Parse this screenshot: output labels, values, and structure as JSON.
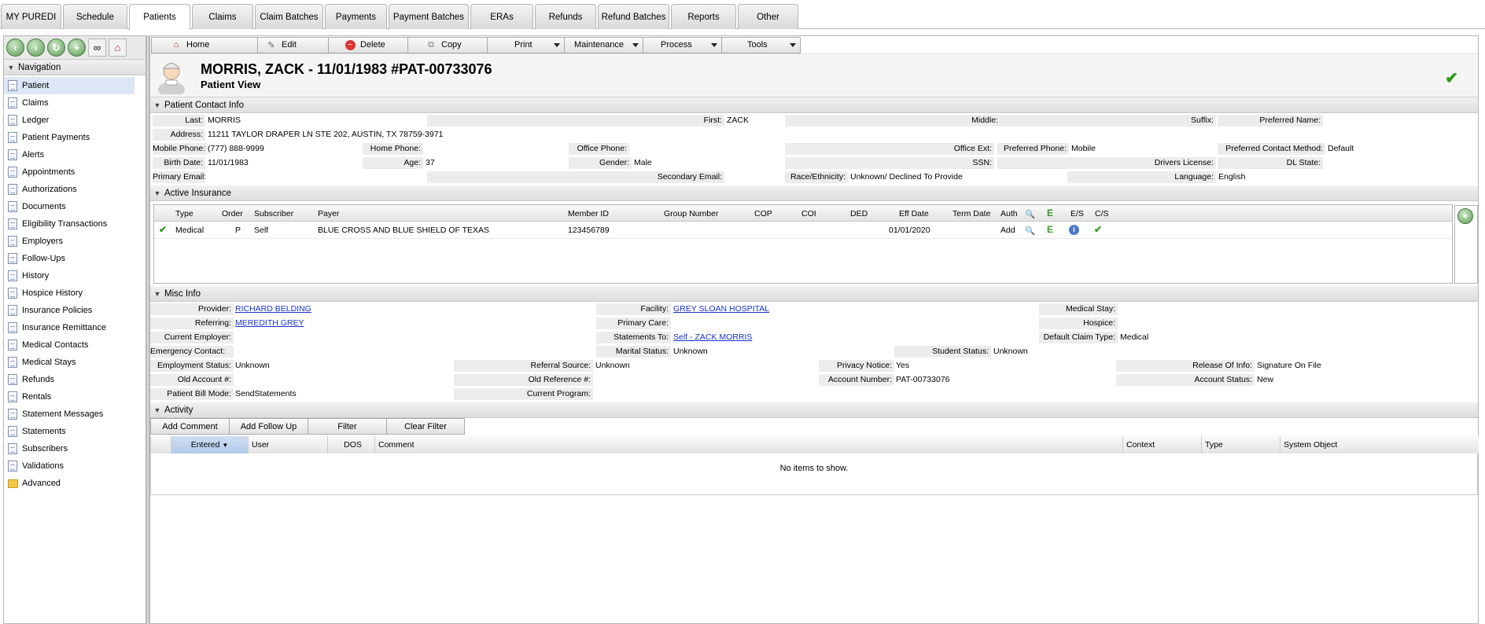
{
  "tabs": [
    "MY PUREDI",
    "Schedule",
    "Patients",
    "Claims",
    "Claim Batches",
    "Payments",
    "Payment Batches",
    "ERAs",
    "Refunds",
    "Refund Batches",
    "Reports",
    "Other"
  ],
  "nav": {
    "title": "Navigation",
    "items": [
      "Patient",
      "Claims",
      "Ledger",
      "Patient Payments",
      "Alerts",
      "Appointments",
      "Authorizations",
      "Documents",
      "Eligibility Transactions",
      "Employers",
      "Follow-Ups",
      "History",
      "Hospice History",
      "Insurance Policies",
      "Insurance Remittance",
      "Medical Contacts",
      "Medical Stays",
      "Refunds",
      "Rentals",
      "Statement Messages",
      "Statements",
      "Subscribers",
      "Validations",
      "Advanced"
    ]
  },
  "toolbar": {
    "home": "Home",
    "edit": "Edit",
    "delete": "Delete",
    "copy": "Copy",
    "print": "Print",
    "maintenance": "Maintenance",
    "process": "Process",
    "tools": "Tools"
  },
  "header": {
    "title": "MORRIS, ZACK - 11/01/1983 #PAT-00733076",
    "subtitle": "Patient View"
  },
  "contact": {
    "section": "Patient Contact Info",
    "last_l": "Last:",
    "last": "MORRIS",
    "first_l": "First:",
    "first": "ZACK",
    "middle_l": "Middle:",
    "suffix_l": "Suffix:",
    "pref_name_l": "Preferred Name:",
    "address_l": "Address:",
    "address": "11211 TAYLOR DRAPER LN STE 202, AUSTIN, TX 78759-3971",
    "mobile_l": "Mobile Phone:",
    "mobile": "(777) 888-9999",
    "home_l": "Home Phone:",
    "office_l": "Office Phone:",
    "office_ext_l": "Office Ext:",
    "pref_phone_l": "Preferred Phone:",
    "pref_phone": "Mobile",
    "pref_contact_l": "Preferred Contact Method:",
    "pref_contact": "Default",
    "birth_l": "Birth Date:",
    "birth": "11/01/1983",
    "age_l": "Age:",
    "age": "37",
    "gender_l": "Gender:",
    "gender": "Male",
    "ssn_l": "SSN:",
    "dl_l": "Drivers License:",
    "dl_state_l": "DL State:",
    "pemail_l": "Primary Email:",
    "semail_l": "Secondary Email:",
    "race_l": "Race/Ethnicity:",
    "race": "Unknown/ Declined To Provide",
    "lang_l": "Language:",
    "lang": "English"
  },
  "insurance": {
    "section": "Active Insurance",
    "headers": [
      "Type",
      "Order",
      "Subscriber",
      "Payer",
      "Member ID",
      "Group Number",
      "COP",
      "COI",
      "DED",
      "Eff Date",
      "Term Date",
      "Auth",
      "",
      "",
      "E/S",
      "C/S"
    ],
    "row": {
      "type": "Medical",
      "order": "P",
      "subscriber": "Self",
      "payer": "BLUE CROSS AND BLUE SHIELD OF TEXAS",
      "member_id": "123456789",
      "eff_date": "01/01/2020",
      "auth": "Add",
      "e_letter": "E"
    }
  },
  "misc": {
    "section": "Misc Info",
    "provider_l": "Provider:",
    "provider": "RICHARD BELDING",
    "facility_l": "Facility:",
    "facility": "GREY SLOAN HOSPITAL",
    "med_stay_l": "Medical Stay:",
    "referring_l": "Referring:",
    "referring": "MEREDITH GREY",
    "primary_care_l": "Primary Care:",
    "hospice_l": "Hospice:",
    "employer_l": "Current Employer:",
    "statements_l": "Statements To:",
    "statements": "Self - ZACK MORRIS",
    "claim_type_l": "Default Claim Type:",
    "claim_type": "Medical",
    "emergency_l": "Emergency Contact:",
    "marital_l": "Marital Status:",
    "marital": "Unknown",
    "student_l": "Student Status:",
    "student": "Unknown",
    "employment_l": "Employment Status:",
    "employment": "Unknown",
    "referral_l": "Referral Source:",
    "referral": "Unknown",
    "privacy_l": "Privacy Notice:",
    "privacy": "Yes",
    "release_l": "Release Of Info:",
    "release": "Signature On File",
    "old_acct_l": "Old Account #:",
    "old_ref_l": "Old Reference #:",
    "acct_num_l": "Account Number:",
    "acct_num": "PAT-00733076",
    "acct_status_l": "Account Status:",
    "acct_status": "New",
    "bill_mode_l": "Patient Bill Mode:",
    "bill_mode": "SendStatements",
    "program_l": "Current Program:"
  },
  "activity": {
    "section": "Activity",
    "buttons": [
      "Add Comment",
      "Add Follow Up",
      "Filter",
      "Clear Filter"
    ],
    "headers": [
      "Entered",
      "User",
      "DOS",
      "Comment",
      "Context",
      "Type",
      "System Object"
    ],
    "empty": "No items to show."
  },
  "colors": {
    "accent": "#2f9a1e",
    "selected": "#dce6f5",
    "label_bg": "#ececec"
  }
}
